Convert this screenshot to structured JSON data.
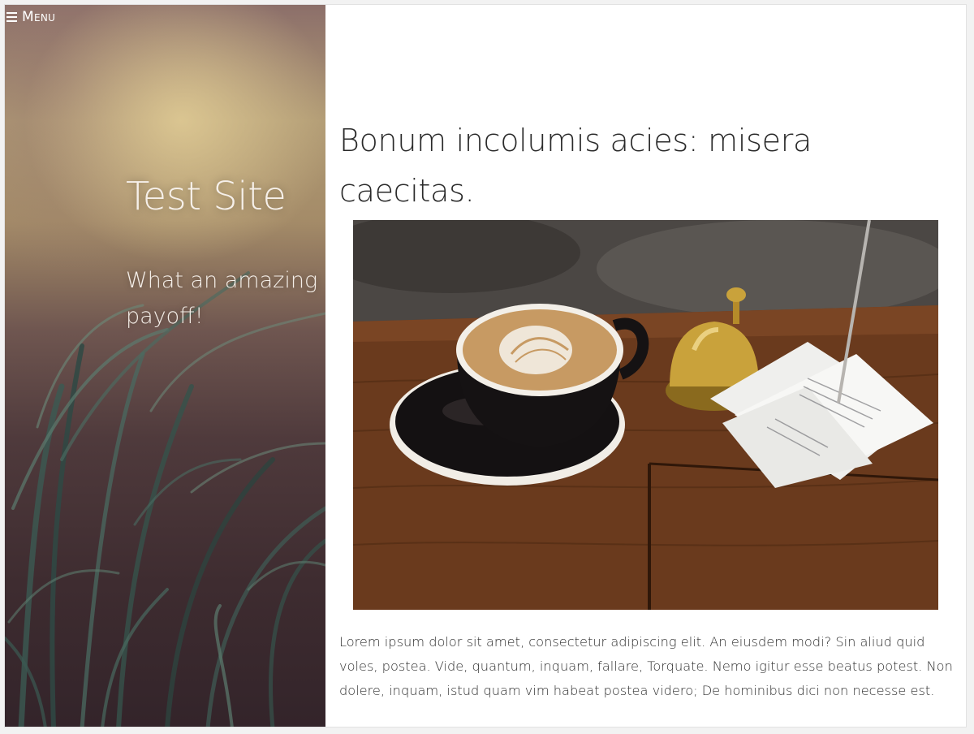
{
  "header": {
    "menu_label": "Menu"
  },
  "site": {
    "title": "Test Site",
    "tagline": "What an amazing payoff!"
  },
  "post": {
    "title": "Bonum incolumis acies: misera caecitas.",
    "body": "Lorem ipsum dolor sit amet, consectetur adipiscing elit. An eiusdem modi? Sin aliud quid voles, postea. Vide, quantum, inquam, fallare, Torquate. Nemo igitur esse beatus potest. Non dolere, inquam, istud quam vim habeat postea videro; De hominibus dici non necesse est."
  },
  "icons": {
    "menu": "hamburger-menu-icon"
  },
  "colors": {
    "sidebar_top": "#b09a74",
    "sidebar_bottom": "#33242a",
    "text_light": "#f6f0ea",
    "text_dark": "#2a2a2a"
  }
}
